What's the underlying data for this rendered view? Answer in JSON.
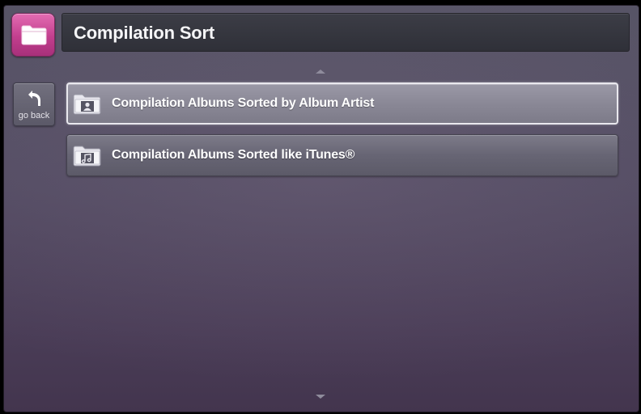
{
  "header": {
    "title": "Compilation Sort",
    "app_icon": "folder-icon"
  },
  "back": {
    "label": "go back",
    "icon": "back-arrow-icon"
  },
  "list": {
    "items": [
      {
        "label": "Compilation Albums Sorted by Album Artist",
        "icon": "folder-person-icon",
        "selected": true
      },
      {
        "label": "Compilation Albums Sorted like iTunes®",
        "icon": "folder-music-icon",
        "selected": false
      }
    ]
  },
  "colors": {
    "accent": "#c23f8e",
    "background": "#514a61",
    "title_bar": "#2f3038",
    "item": "#676574"
  }
}
